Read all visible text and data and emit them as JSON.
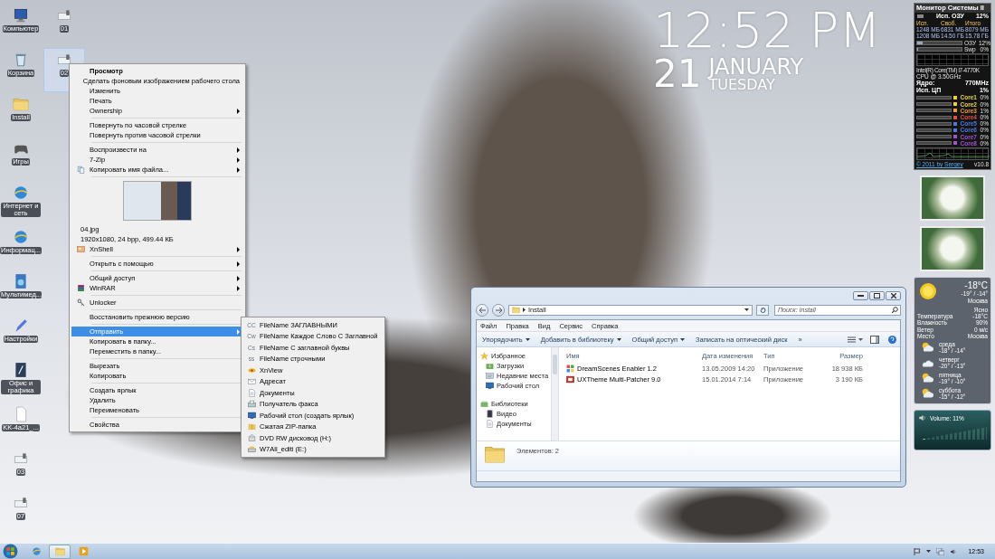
{
  "desktop_icons": [
    {
      "label": "Компьютер",
      "selected": false
    },
    {
      "label": "Корзина",
      "selected": false
    },
    {
      "label": "Install",
      "selected": false
    },
    {
      "label": "Игры",
      "selected": false
    },
    {
      "label": "Интернет и сеть",
      "selected": false
    },
    {
      "label": "Информац...",
      "selected": false
    },
    {
      "label": "Мультимед...",
      "selected": false
    },
    {
      "label": "Настройки",
      "selected": false
    },
    {
      "label": "Офис и графика",
      "selected": false
    },
    {
      "label": "KK-4a21_...",
      "selected": false
    },
    {
      "label": "03",
      "selected": false
    },
    {
      "label": "07",
      "selected": false
    },
    {
      "label": "01",
      "selected": false
    },
    {
      "label": "02",
      "selected": true
    }
  ],
  "clock": {
    "time": "12:52 PM",
    "day": "21",
    "month": "JANUARY",
    "weekday": "TUESDAY"
  },
  "context_menu": {
    "items": [
      {
        "kind": "item",
        "label": "Просмотр",
        "bold": true,
        "submenu": false,
        "selected": false
      },
      {
        "kind": "item",
        "label": "Сделать фоновым изображением рабочего стола",
        "bold": false,
        "submenu": false,
        "selected": false
      },
      {
        "kind": "item",
        "label": "Изменить",
        "bold": false,
        "submenu": false,
        "selected": false
      },
      {
        "kind": "item",
        "label": "Печать",
        "bold": false,
        "submenu": false,
        "selected": false
      },
      {
        "kind": "item",
        "label": "Ownership",
        "bold": false,
        "submenu": true,
        "selected": false
      },
      {
        "kind": "separator"
      },
      {
        "kind": "item",
        "label": "Повернуть по часовой стрелке",
        "bold": false,
        "submenu": false,
        "selected": false
      },
      {
        "kind": "item",
        "label": "Повернуть против часовой стрелки",
        "bold": false,
        "submenu": false,
        "selected": false
      },
      {
        "kind": "separator"
      },
      {
        "kind": "item",
        "label": "Воспроизвести на",
        "bold": false,
        "submenu": true,
        "selected": false
      },
      {
        "kind": "item",
        "label": "7-Zip",
        "bold": false,
        "submenu": true,
        "selected": false
      },
      {
        "kind": "item",
        "label": "Копировать имя файла...",
        "bold": false,
        "submenu": true,
        "selected": false
      },
      {
        "kind": "separator"
      },
      {
        "kind": "preview"
      },
      {
        "kind": "info",
        "label": "04.jpg"
      },
      {
        "kind": "info",
        "label": "1920x1080, 24 bpp, 499.44 КБ"
      },
      {
        "kind": "item",
        "label": "XnShell",
        "bold": false,
        "submenu": true,
        "selected": false
      },
      {
        "kind": "separator"
      },
      {
        "kind": "item",
        "label": "Открыть с помощью",
        "bold": false,
        "submenu": true,
        "selected": false
      },
      {
        "kind": "separator"
      },
      {
        "kind": "item",
        "label": "Общий доступ",
        "bold": false,
        "submenu": true,
        "selected": false
      },
      {
        "kind": "item",
        "label": "WinRAR",
        "bold": false,
        "submenu": true,
        "selected": false
      },
      {
        "kind": "separator"
      },
      {
        "kind": "item",
        "label": "Unlocker",
        "bold": false,
        "submenu": false,
        "selected": false
      },
      {
        "kind": "separator"
      },
      {
        "kind": "item",
        "label": "Восстановить прежнюю версию",
        "bold": false,
        "submenu": false,
        "selected": false
      },
      {
        "kind": "separator"
      },
      {
        "kind": "item",
        "label": "Отправить",
        "bold": false,
        "submenu": true,
        "selected": true
      },
      {
        "kind": "item",
        "label": "Копировать в папку...",
        "bold": false,
        "submenu": false,
        "selected": false
      },
      {
        "kind": "item",
        "label": "Переместить в папку...",
        "bold": false,
        "submenu": false,
        "selected": false
      },
      {
        "kind": "separator"
      },
      {
        "kind": "item",
        "label": "Вырезать",
        "bold": false,
        "submenu": false,
        "selected": false
      },
      {
        "kind": "item",
        "label": "Копировать",
        "bold": false,
        "submenu": false,
        "selected": false
      },
      {
        "kind": "separator"
      },
      {
        "kind": "item",
        "label": "Создать ярлык",
        "bold": false,
        "submenu": false,
        "selected": false
      },
      {
        "kind": "item",
        "label": "Удалить",
        "bold": false,
        "submenu": false,
        "selected": false
      },
      {
        "kind": "item",
        "label": "Переименовать",
        "bold": false,
        "submenu": false,
        "selected": false
      },
      {
        "kind": "separator"
      },
      {
        "kind": "item",
        "label": "Свойства",
        "bold": false,
        "submenu": false,
        "selected": false
      }
    ]
  },
  "send_to_menu": {
    "items": [
      {
        "badge": "CC",
        "label": "FileName ЗАГЛАВНЫМИ"
      },
      {
        "badge": "Cw",
        "label": "FileName Каждое Слово С Заглавной"
      },
      {
        "badge": "Cs",
        "label": "FileName С заглавной буквы"
      },
      {
        "badge": "ss",
        "label": "FileName строчными"
      },
      {
        "label": "XnView"
      },
      {
        "label": "Адресат"
      },
      {
        "label": "Документы"
      },
      {
        "label": "Получатель факса"
      },
      {
        "label": "Рабочий стол (создать ярлык)"
      },
      {
        "label": "Сжатая ZIP-папка"
      },
      {
        "label": "DVD RW дисковод (H:)"
      },
      {
        "label": "W7All_editi (E:)"
      }
    ]
  },
  "explorer": {
    "path": "Install",
    "search": {
      "placeholder": "Поиск: Install"
    },
    "menu": [
      "Файл",
      "Правка",
      "Вид",
      "Сервис",
      "Справка"
    ],
    "toolbar": [
      {
        "label": "Упорядочить",
        "dropdown": true
      },
      {
        "label": "Добавить в библиотеку",
        "dropdown": true
      },
      {
        "label": "Общий доступ",
        "dropdown": true
      },
      {
        "label": "Записать на оптический диск",
        "dropdown": false
      },
      {
        "label": "»",
        "dropdown": false
      }
    ],
    "nav": [
      {
        "label": "Избранное",
        "children": [
          {
            "label": "Загрузки"
          },
          {
            "label": "Недавние места"
          },
          {
            "label": "Рабочий стол"
          }
        ]
      },
      {
        "label": "Библиотеки",
        "children": [
          {
            "label": "Видео"
          },
          {
            "label": "Документы"
          }
        ]
      }
    ],
    "columns": [
      "Имя",
      "Дата изменения",
      "Тип",
      "Размер"
    ],
    "rows": [
      {
        "cells": [
          "DreamScenes Enabler 1.2",
          "13.05.2009 14:20",
          "Приложение",
          "18 938 КБ"
        ]
      },
      {
        "cells": [
          "UXTheme Multi-Patcher 9.0",
          "15.01.2014 7:14",
          "Приложение",
          "3 190 КБ"
        ]
      }
    ],
    "details": "Элементов: 2"
  },
  "system_monitor": {
    "title": "Монитор Системы II",
    "ram_label": "Исп. ОЗУ",
    "ram_value": "12%",
    "mem_headers": [
      "Исп.",
      "Своб.",
      "Итого"
    ],
    "mem_rows": [
      [
        "1248 МБ",
        "6831 МБ",
        "8079 МБ"
      ],
      [
        "1208 МБ",
        "14.50 ГБ",
        "15.78 ГБ"
      ]
    ],
    "bars": [
      {
        "label": "ОЗУ",
        "value": "12%",
        "level": 0.12
      },
      {
        "label": "Swp",
        "value": "0%",
        "level": 0.03
      }
    ],
    "cpu_name": "Intel(R) Core(TM) i7-4770K",
    "cpu_speed": "CPU @ 3.50GHz",
    "core_label": "Ядро:",
    "core_value": "770MHz",
    "cpu_label": "Исп. ЦП",
    "cpu_value": "1%",
    "cores": [
      {
        "label": "Core1",
        "value": "0%",
        "color": "#e8d040"
      },
      {
        "label": "Core2",
        "value": "0%",
        "color": "#e8d040"
      },
      {
        "label": "Core3",
        "value": "1%",
        "color": "#f09a30"
      },
      {
        "label": "Core4",
        "value": "0%",
        "color": "#e05040"
      },
      {
        "label": "Core5",
        "value": "0%",
        "color": "#4a7ae0"
      },
      {
        "label": "Core6",
        "value": "0%",
        "color": "#4a7ae0"
      },
      {
        "label": "Core7",
        "value": "0%",
        "color": "#a050d0"
      },
      {
        "label": "Core8",
        "value": "0%",
        "color": "#a050d0"
      }
    ],
    "footer": "© 2011 by Sergey",
    "version": "v10.8"
  },
  "weather": {
    "temp": "-18°C",
    "range": "-19° / -14°",
    "city": "Москва",
    "condition": "Ясно",
    "details": [
      {
        "label": "Температура",
        "value": "-18°C"
      },
      {
        "label": "Влажность",
        "value": "90%"
      },
      {
        "label": "Ветер",
        "value": "0 м/с"
      },
      {
        "label": "Место",
        "value": "Москва"
      }
    ],
    "forecast": [
      {
        "day": "среда",
        "range": "-18° / -14°"
      },
      {
        "day": "четверг",
        "range": "-20° / -13°"
      },
      {
        "day": "пятница",
        "range": "-19° / -10°"
      },
      {
        "day": "суббота",
        "range": "-15° / -12°"
      }
    ]
  },
  "volume": {
    "label": "Volume: 11%",
    "level": 0.11
  },
  "taskbar": {
    "buttons": [
      {
        "selected": false
      },
      {
        "selected": true
      },
      {
        "selected": false
      }
    ],
    "time": "12:53"
  }
}
